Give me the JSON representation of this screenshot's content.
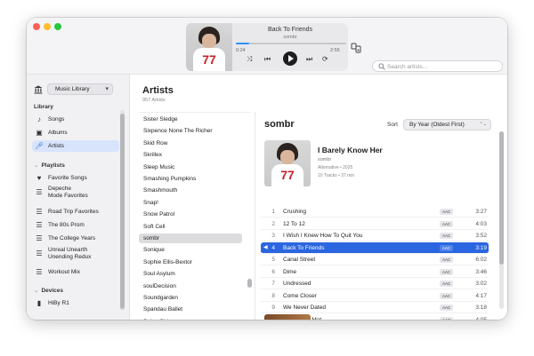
{
  "now_playing": {
    "title": "Back To Friends",
    "artist": "sombr",
    "elapsed": "0:24",
    "remaining": "2:55",
    "progress_fraction": 0.12,
    "art_number": "77"
  },
  "search": {
    "placeholder": "Search artists..."
  },
  "sidebar": {
    "library_selector": "Music Library",
    "library_heading": "Library",
    "library_items": [
      {
        "label": "Songs",
        "icon": "music-note-icon"
      },
      {
        "label": "Albums",
        "icon": "album-icon"
      },
      {
        "label": "Artists",
        "icon": "microphone-icon",
        "active": true
      }
    ],
    "playlists_heading": "Playlists",
    "playlists": [
      {
        "label": "Favorite Songs",
        "icon": "heart-icon"
      },
      {
        "label": "Depeche",
        "label2": "Mode Favorites",
        "icon": "playlist-icon"
      },
      {
        "label": "Road Trip Favorites",
        "icon": "playlist-icon"
      },
      {
        "label": "The 80s Prom",
        "icon": "playlist-icon"
      },
      {
        "label": "The College Years",
        "icon": "playlist-icon"
      },
      {
        "label": "Unreal Unearth",
        "label2": "Unending Redux",
        "icon": "playlist-icon"
      },
      {
        "label": "Workout Mix",
        "icon": "playlist-icon"
      }
    ],
    "devices_heading": "Devices",
    "devices": [
      {
        "label": "HiBy R1",
        "icon": "device-icon"
      }
    ]
  },
  "artists_panel": {
    "title": "Artists",
    "count": "957 Artists",
    "items": [
      "Sister Sledge",
      "Sixpence None The Richer",
      "Skid Row",
      "Skrillex",
      "Sleep Music",
      "Smashing Pumpkins",
      "Smashmouth",
      "Snap!",
      "Snow Patrol",
      "Soft Cell",
      "sombr",
      "Sonique",
      "Sophie Ellis-Bextor",
      "Soul Asylum",
      "soulDecision",
      "Soundgarden",
      "Spandau Ballet",
      "Spice Girls"
    ],
    "active_index": 10
  },
  "detail": {
    "artist_name": "sombr",
    "sort_label": "Sort",
    "sort_value": "By Year (Oldest First)",
    "album": {
      "title": "I Barely Know Her",
      "artist": "sombr",
      "meta": "Alternative • 2025",
      "meta2": "10 Tracks • 37 min",
      "art_number": "77"
    },
    "tracks": [
      {
        "n": "1",
        "title": "Crushing",
        "badge": "AAC",
        "dur": "3:27"
      },
      {
        "n": "2",
        "title": "12 To 12",
        "badge": "AAC",
        "dur": "4:03"
      },
      {
        "n": "3",
        "title": "I Wish I Knew How To Quit You",
        "badge": "AAC",
        "dur": "3:52"
      },
      {
        "n": "4",
        "title": "Back To Friends",
        "badge": "AAC",
        "dur": "3:19",
        "playing": true
      },
      {
        "n": "5",
        "title": "Canal Street",
        "badge": "AAC",
        "dur": "6:02"
      },
      {
        "n": "6",
        "title": "Dime",
        "badge": "AAC",
        "dur": "3:46"
      },
      {
        "n": "7",
        "title": "Undressed",
        "badge": "AAC",
        "dur": "3:02"
      },
      {
        "n": "8",
        "title": "Come Closer",
        "badge": "AAC",
        "dur": "4:17"
      },
      {
        "n": "9",
        "title": "We Never Dated",
        "badge": "AAC",
        "dur": "3:18"
      },
      {
        "n": "10",
        "title": "Under The Mat",
        "badge": "AAC",
        "dur": "4:05"
      }
    ]
  },
  "colors": {
    "accent": "#2b66e0",
    "active_sidebar": "#d8e4fb"
  }
}
